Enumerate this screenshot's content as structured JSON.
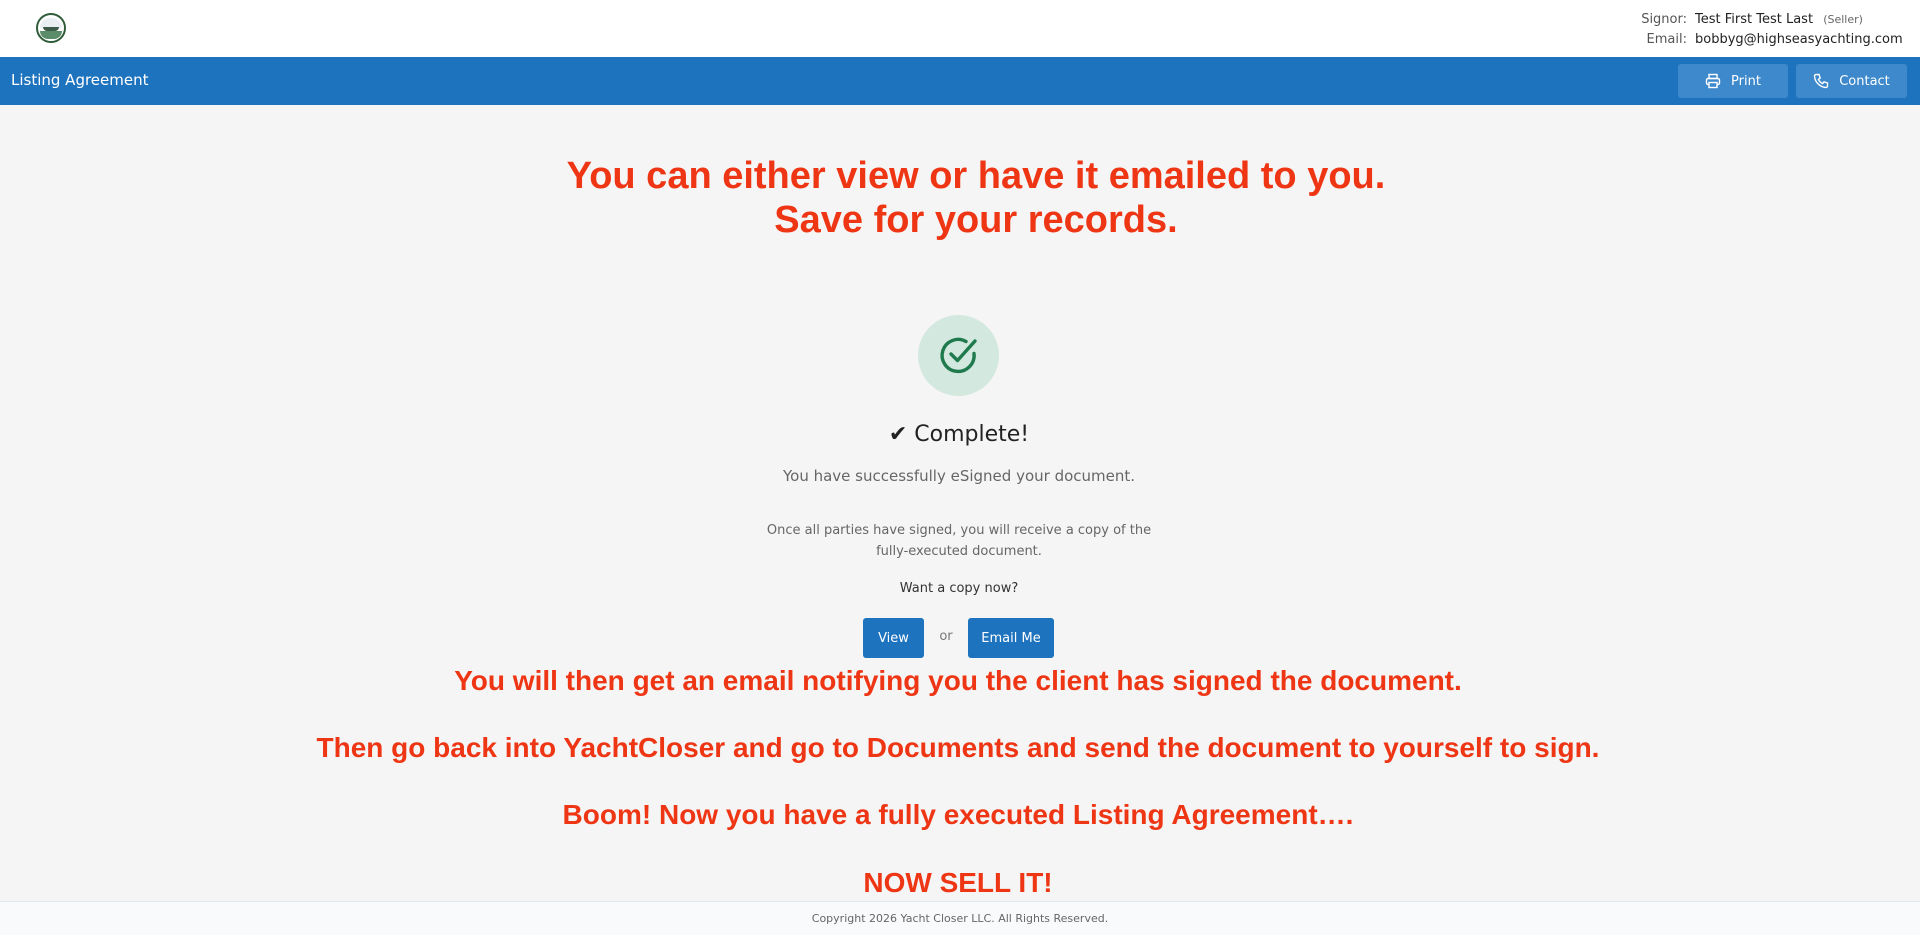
{
  "header": {
    "signor_label": "Signor:",
    "signor_name": "Test First Test Last",
    "signor_role": "(Seller)",
    "email_label": "Email:",
    "email_value": "bobbyg@highseasyachting.com"
  },
  "navbar": {
    "title": "Listing Agreement",
    "print_label": "Print",
    "contact_label": "Contact"
  },
  "annotations": {
    "top_line1": "You can either view or have it emailed to you.",
    "top_line2": "Save for your records.",
    "line1": "You will then get an email notifying you the client has signed the document.",
    "line2": "Then go back into YachtCloser and go to Documents and send the document to yourself to sign.",
    "line3": "Boom! Now you have a fully executed Listing Agreement….",
    "line4": "NOW SELL IT!"
  },
  "main": {
    "complete_title": "✔ Complete!",
    "subtitle": "You have successfully eSigned your document.",
    "note": "Once all parties have signed, you will receive a copy of the fully-executed document.",
    "want_copy": "Want a copy now?",
    "view_label": "View",
    "or_label": "or",
    "email_me_label": "Email Me"
  },
  "footer": {
    "copyright": "Copyright 2026 Yacht Closer LLC. All Rights Reserved."
  },
  "icons": {
    "logo": "yacht-logo-icon",
    "print": "printer-icon",
    "contact": "phone-icon",
    "success": "check-circle-icon"
  },
  "colors": {
    "primary": "#1e73be",
    "annotation": "#ee3514",
    "success": "#1f7a4d",
    "success_bg": "#d3e8df"
  }
}
